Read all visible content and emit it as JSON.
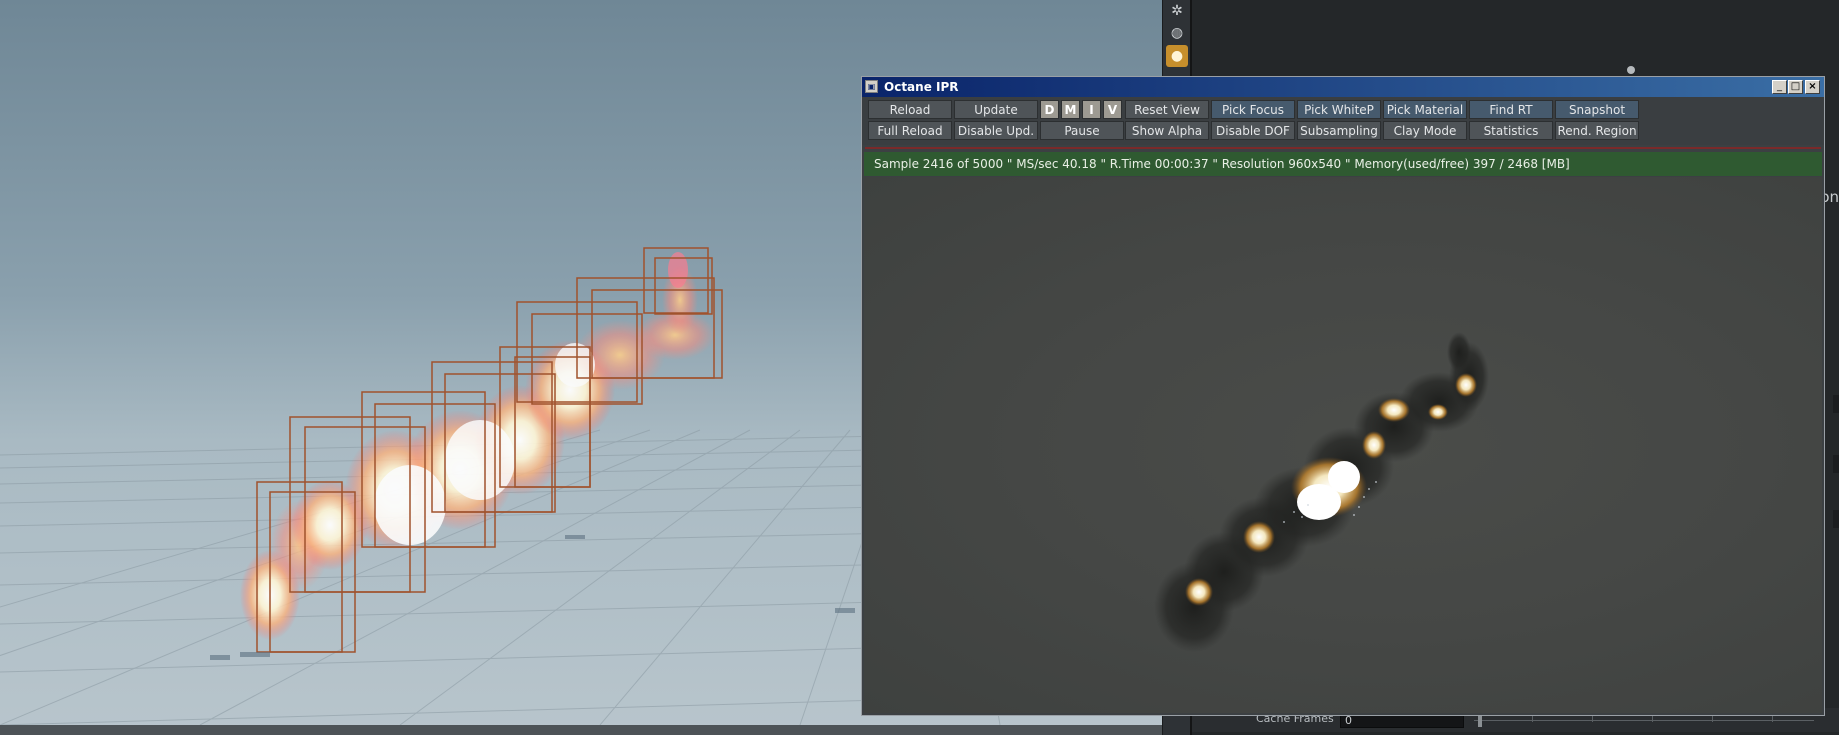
{
  "ipr_window": {
    "title": "Octane IPR",
    "title_icon": "window-icon",
    "controls": {
      "minimize": "minimize-icon",
      "maximize": "maximize-icon",
      "close": "close-icon"
    },
    "toolbar_row1": {
      "reload": "Reload",
      "update": "Update",
      "toggle_d": "D",
      "toggle_m": "M",
      "toggle_i": "I",
      "toggle_v": "V",
      "reset_view": "Reset View",
      "pick_focus": "Pick Focus",
      "pick_whitep": "Pick WhiteP",
      "pick_material": "Pick Material",
      "find_rt": "Find RT",
      "snapshot": "Snapshot"
    },
    "toolbar_row2": {
      "full_reload": "Full Reload",
      "disable_upd": "Disable Upd.",
      "pause": "Pause",
      "show_alpha": "Show Alpha",
      "disable_dof": "Disable DOF",
      "subsampling": "Subsampling",
      "clay_mode": "Clay Mode",
      "statistics": "Statistics",
      "rend_region": "Rend. Region"
    },
    "status": "Sample 2416 of 5000 \" MS/sec 40.18 \" R.Time 00:00:37 \" Resolution 960x540 \" Memory(used/free) 397 / 2468 [MB]"
  },
  "right_panel": {
    "cache_frames_label": "Cache Frames",
    "cache_frames_value": "0",
    "cut_text": "on"
  },
  "shelf_icons": [
    "light-bulb-icon",
    "sphere-light-icon",
    "light-bulb-active-icon"
  ],
  "colors": {
    "status_bar": "#2f5a31",
    "title_bar": "#0a246a",
    "active_shelf": "#c78f2c",
    "bounding_box": "#a0522d"
  }
}
